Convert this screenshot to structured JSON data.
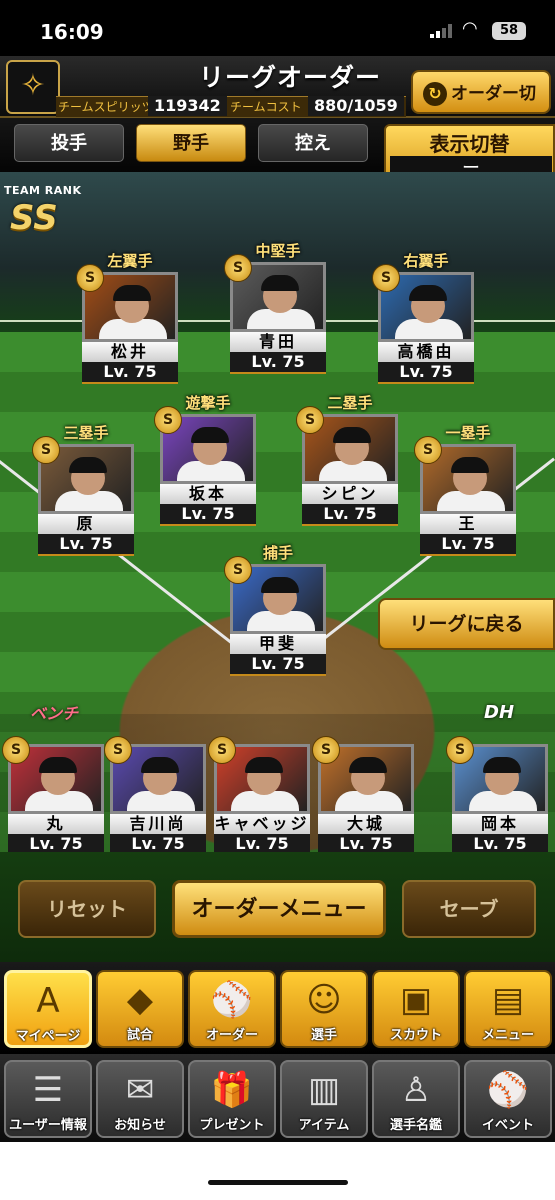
{
  "status_bar": {
    "time": "16:09",
    "battery": "58"
  },
  "header": {
    "title": "リーグオーダー",
    "team_spirit_label": "チームスピリッツ",
    "team_spirit_value": "119342",
    "team_cost_label": "チームコスト",
    "team_cost_value": "880/1059",
    "order_switch_label": "オーダー切替"
  },
  "tabs": [
    {
      "label": "投手",
      "active": false
    },
    {
      "label": "野手",
      "active": true
    },
    {
      "label": "控え",
      "active": false
    }
  ],
  "display_switch": {
    "label": "表示切替",
    "value": "ー"
  },
  "team_rank": {
    "label": "TEAM RANK",
    "value": "SS"
  },
  "fielders": [
    {
      "position": "左翼手",
      "name": "松井",
      "level": "Lv. 75",
      "badge": "S",
      "bg": "#a24d16"
    },
    {
      "position": "中堅手",
      "name": "青田",
      "level": "Lv. 75",
      "badge": "S",
      "bg": "#5c5c5c"
    },
    {
      "position": "右翼手",
      "name": "高橋由",
      "level": "Lv. 75",
      "badge": "S",
      "bg": "#2d6ab0"
    },
    {
      "position": "遊撃手",
      "name": "坂本",
      "level": "Lv. 75",
      "badge": "S",
      "bg": "#7a45c0"
    },
    {
      "position": "二塁手",
      "name": "シピン",
      "level": "Lv. 75",
      "badge": "S",
      "bg": "#a8551a"
    },
    {
      "position": "三塁手",
      "name": "原",
      "level": "Lv. 75",
      "badge": "S",
      "bg": "#7a5a3a"
    },
    {
      "position": "一塁手",
      "name": "王",
      "level": "Lv. 75",
      "badge": "S",
      "bg": "#b06a2a"
    },
    {
      "position": "捕手",
      "name": "甲斐",
      "level": "Lv. 75",
      "badge": "S",
      "bg": "#3a6ac8"
    }
  ],
  "return_button": "リーグに戻る",
  "bench_label": "ベンチ",
  "dh_label": "DH",
  "bench": [
    {
      "name": "丸",
      "level": "Lv. 75",
      "badge": "S",
      "bg": "#c0303a"
    },
    {
      "name": "吉川尚",
      "level": "Lv. 75",
      "badge": "S",
      "bg": "#5a4ab0"
    },
    {
      "name": "キャベッジ",
      "level": "Lv. 75",
      "badge": "S",
      "bg": "#d0402a"
    },
    {
      "name": "大城",
      "level": "Lv. 75",
      "badge": "S",
      "bg": "#c0702a"
    },
    {
      "name": "岡本",
      "level": "Lv. 75",
      "badge": "S",
      "bg": "#5a90d0"
    }
  ],
  "actions": {
    "reset": "リセット",
    "order_menu": "オーダーメニュー",
    "save": "セーブ"
  },
  "nav_primary": [
    {
      "label": "マイページ",
      "icon": "A"
    },
    {
      "label": "試合",
      "icon": "◆"
    },
    {
      "label": "オーダー",
      "icon": "⚾"
    },
    {
      "label": "選手",
      "icon": "☺"
    },
    {
      "label": "スカウト",
      "icon": "▣"
    },
    {
      "label": "メニュー",
      "icon": "▤"
    }
  ],
  "nav_secondary": [
    {
      "label": "ユーザー情報",
      "icon": "☰"
    },
    {
      "label": "お知らせ",
      "icon": "✉"
    },
    {
      "label": "プレゼント",
      "icon": "🎁"
    },
    {
      "label": "アイテム",
      "icon": "▥"
    },
    {
      "label": "選手名鑑",
      "icon": "♙"
    },
    {
      "label": "イベント",
      "icon": "⚾"
    }
  ]
}
